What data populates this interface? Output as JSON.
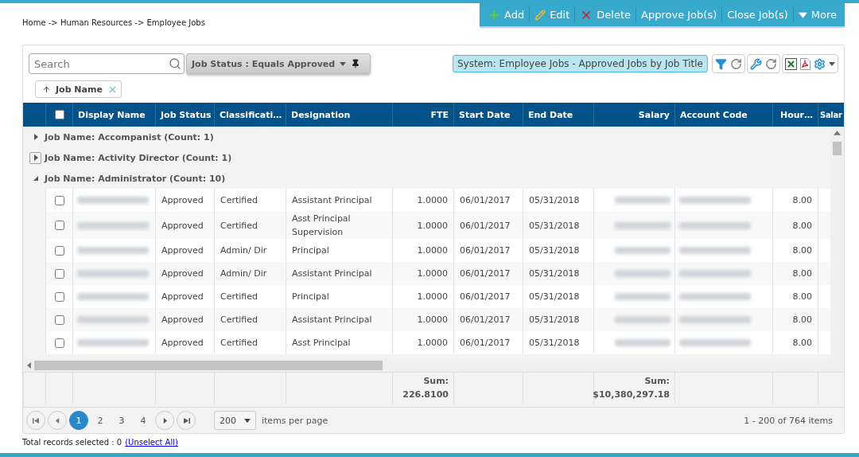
{
  "breadcrumb": "Home -> Human Resources -> Employee Jobs",
  "actions": [
    {
      "label": "Add",
      "kind": "add"
    },
    {
      "label": "Edit",
      "kind": "edit"
    },
    {
      "label": "Delete",
      "kind": "delete"
    },
    {
      "label": "Approve Job(s)",
      "kind": "plain"
    },
    {
      "label": "Close Job(s)",
      "kind": "plain"
    },
    {
      "label": "More",
      "kind": "menu"
    }
  ],
  "search": {
    "placeholder": "Search"
  },
  "filter_chip": {
    "label": "Job Status : Equals Approved"
  },
  "view_name": "System: Employee Jobs - Approved Jobs by Job Title",
  "group_chip": {
    "label": "Job Name"
  },
  "table": {
    "select_all_checked": false,
    "columns": [
      {
        "label": "Display Name",
        "kind": "blurred"
      },
      {
        "label": "Job Status",
        "kind": "text"
      },
      {
        "label": "Classificati…",
        "kind": "text"
      },
      {
        "label": "Designation",
        "kind": "text"
      },
      {
        "label": "FTE",
        "kind": "number",
        "sum": {
          "label": "Sum:",
          "value": "226.8100"
        }
      },
      {
        "label": "Start Date",
        "kind": "text"
      },
      {
        "label": "End Date",
        "kind": "text"
      },
      {
        "label": "Salary",
        "kind": "blurred-number",
        "sum": {
          "label": "Sum:",
          "value": "$10,380,297.18"
        }
      },
      {
        "label": "Account Code",
        "kind": "blurred"
      },
      {
        "label": "Hour…",
        "kind": "number"
      },
      {
        "label": "Salar",
        "kind": "blank"
      }
    ],
    "groups": [
      {
        "label": "Job Name: Accompanist (Count: 1)",
        "expanded": false,
        "focused": false
      },
      {
        "label": "Job Name: Activity Director (Count: 1)",
        "expanded": false,
        "focused": true
      },
      {
        "label": "Job Name: Administrator (Count: 10)",
        "expanded": true,
        "focused": false
      }
    ],
    "rows": [
      {
        "checked": false,
        "cells": [
          "",
          "Approved",
          "Certified",
          "Assistant Principal",
          "1.0000",
          "06/01/2017",
          "05/31/2018",
          "",
          "",
          "8.00",
          ""
        ]
      },
      {
        "checked": false,
        "cells": [
          "",
          "Approved",
          "Certified",
          "Asst Principal Supervision",
          "1.0000",
          "06/01/2017",
          "05/31/2018",
          "",
          "",
          "8.00",
          ""
        ]
      },
      {
        "checked": false,
        "cells": [
          "",
          "Approved",
          "Admin/ Dir",
          "Principal",
          "1.0000",
          "06/01/2017",
          "05/31/2018",
          "",
          "",
          "8.00",
          ""
        ]
      },
      {
        "checked": false,
        "cells": [
          "",
          "Approved",
          "Admin/ Dir",
          "Assistant Principal",
          "1.0000",
          "06/01/2017",
          "05/31/2018",
          "",
          "",
          "8.00",
          ""
        ]
      },
      {
        "checked": false,
        "cells": [
          "",
          "Approved",
          "Certified",
          "Principal",
          "1.0000",
          "06/01/2017",
          "05/31/2018",
          "",
          "",
          "8.00",
          ""
        ]
      },
      {
        "checked": false,
        "cells": [
          "",
          "Approved",
          "Certified",
          "Assistant Principal",
          "1.0000",
          "06/01/2017",
          "05/31/2018",
          "",
          "",
          "8.00",
          ""
        ]
      },
      {
        "checked": false,
        "cells": [
          "",
          "Approved",
          "Certified",
          "Asst Principal",
          "1.0000",
          "06/01/2017",
          "05/31/2018",
          "",
          "",
          "8.00",
          ""
        ]
      }
    ]
  },
  "pager": {
    "pages": [
      {
        "label": "1",
        "selected": true
      },
      {
        "label": "2",
        "selected": false
      },
      {
        "label": "3",
        "selected": false
      },
      {
        "label": "4",
        "selected": false
      }
    ],
    "page_size": "200",
    "page_size_label": "items per page",
    "summary": "1 - 200 of 764 items"
  },
  "selection": {
    "text": "Total records selected : 0",
    "link": "(Unselect All)"
  }
}
